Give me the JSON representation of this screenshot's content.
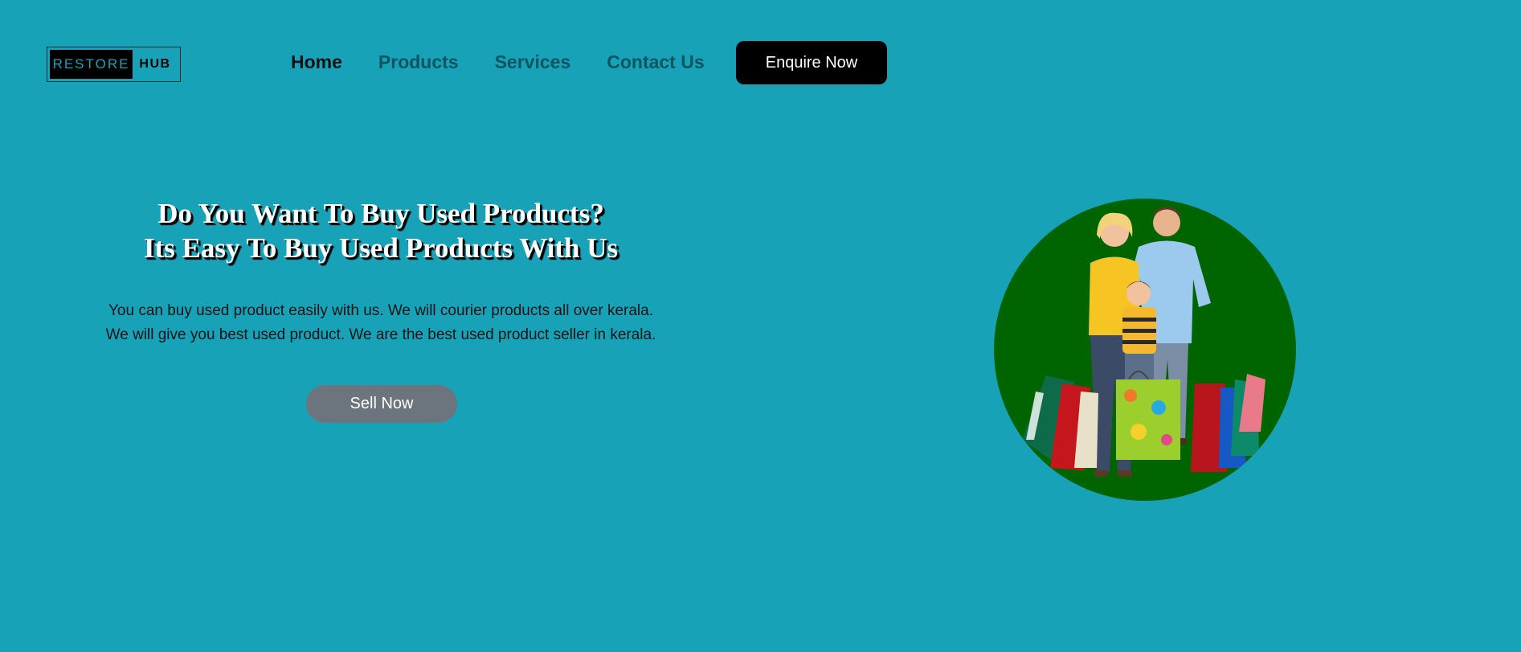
{
  "logo": {
    "part1": "RESTORE",
    "part2": "HUB"
  },
  "nav": {
    "items": [
      "Home",
      "Products",
      "Services",
      "Contact Us"
    ],
    "cta": "Enquire Now"
  },
  "hero": {
    "headline_line1": "Do You Want To Buy Used Products?",
    "headline_line2": "Its Easy To Buy Used Products With Us",
    "desc_line1": "You can buy used product easily with us. We will courier products all over kerala.",
    "desc_line2": "We will give you best used product. We are the best used product seller in kerala.",
    "button": "Sell Now"
  },
  "colors": {
    "background": "#18a2b8",
    "circle": "#006400",
    "cta": "#000000",
    "secondary_button": "#6c757d"
  }
}
